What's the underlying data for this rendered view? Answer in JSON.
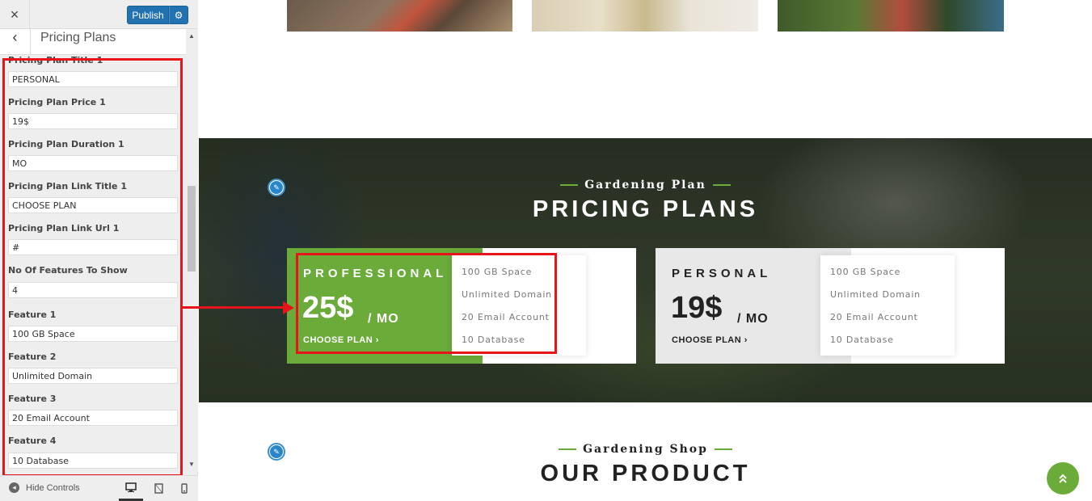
{
  "customizer": {
    "close_icon": "×",
    "publish_label": "Publish",
    "gear_icon": "⚙",
    "back_icon": "‹",
    "section_title": "Pricing Plans",
    "fields": [
      {
        "label": "Pricing Plan Title 1",
        "value": "PERSONAL"
      },
      {
        "label": "Pricing Plan Price 1",
        "value": "19$"
      },
      {
        "label": "Pricing Plan Duration 1",
        "value": "MO"
      },
      {
        "label": "Pricing Plan Link Title 1",
        "value": "CHOOSE PLAN"
      },
      {
        "label": "Pricing Plan Link Url 1",
        "value": "#"
      },
      {
        "label": "No Of Features To Show",
        "value": "4"
      },
      {
        "label": "Feature 1",
        "value": "100 GB Space"
      },
      {
        "label": "Feature 2",
        "value": "Unlimited Domain"
      },
      {
        "label": "Feature 3",
        "value": "20 Email Account"
      },
      {
        "label": "Feature 4",
        "value": "10 Database"
      }
    ],
    "hide_controls_label": "Hide Controls",
    "devices": [
      "desktop-icon",
      "tablet-icon",
      "mobile-icon"
    ]
  },
  "preview": {
    "pricing": {
      "subtitle": "Gardening Plan",
      "title": "PRICING PLANS",
      "plans": [
        {
          "name": "PROFESSIONAL",
          "price": "25$",
          "duration": "/ MO",
          "link": "CHOOSE PLAN ›",
          "features": [
            "100 GB Space",
            "Unlimited Domain",
            "20 Email Account",
            "10 Database"
          ],
          "accent": "#6aab3a"
        },
        {
          "name": "PERSONAL",
          "price": "19$",
          "duration": "/ MO",
          "link": "CHOOSE PLAN ›",
          "features": [
            "100 GB Space",
            "Unlimited Domain",
            "20 Email Account",
            "10 Database"
          ],
          "accent": "#e8e8e8"
        }
      ]
    },
    "product": {
      "subtitle": "Gardening Shop",
      "title": "OUR PRODUCT"
    },
    "scroll_top_icon": "«"
  },
  "colors": {
    "brand_green": "#6aab3a",
    "publish_blue": "#2271b1",
    "annotation_red": "#e8141c"
  }
}
